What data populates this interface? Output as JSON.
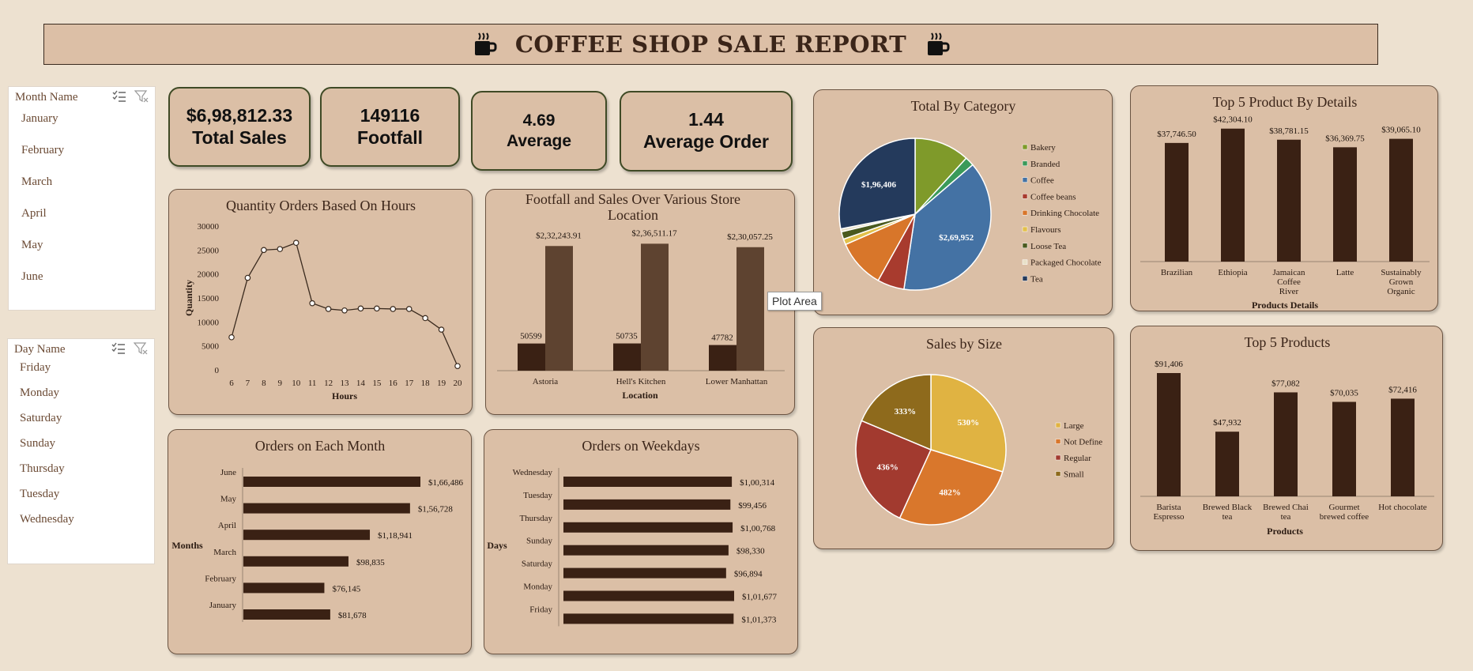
{
  "header": {
    "title": "COFFEE SHOP SALE REPORT",
    "icon": "coffee-cup-icon"
  },
  "tooltip": "Plot Area",
  "slicers": {
    "month": {
      "title": "Month Name",
      "items": [
        "January",
        "February",
        "March",
        "April",
        "May",
        "June"
      ]
    },
    "day": {
      "title": "Day Name",
      "items": [
        "Friday",
        "Monday",
        "Saturday",
        "Sunday",
        "Thursday",
        "Tuesday",
        "Wednesday"
      ]
    }
  },
  "kpis": [
    {
      "value": "$6,98,812.33",
      "label": "Total Sales"
    },
    {
      "value": "149116",
      "label": "Footfall"
    },
    {
      "value": "4.69",
      "label": "Average"
    },
    {
      "value": "1.44",
      "label": "Average Order"
    }
  ],
  "colors": {
    "dark_bar": "#3a2114",
    "mid_bar": "#5e4330",
    "panel": "#dbbfa6",
    "line": "#3a2a1e"
  },
  "chart_data": [
    {
      "id": "hours",
      "type": "line",
      "title": "Quantity Orders Based On Hours",
      "xlabel": "Hours",
      "ylabel": "Quantity",
      "x": [
        6,
        7,
        8,
        9,
        10,
        11,
        12,
        13,
        14,
        15,
        16,
        17,
        18,
        19,
        20
      ],
      "y": [
        6800,
        19200,
        25000,
        25200,
        26500,
        13900,
        12700,
        12400,
        12800,
        12800,
        12700,
        12700,
        10800,
        8400,
        800
      ],
      "ylim": [
        0,
        30000
      ],
      "yticks": [
        "0",
        "5000",
        "10000",
        "15000",
        "20000",
        "25000",
        "30000"
      ],
      "grid": false
    },
    {
      "id": "location",
      "type": "bar",
      "title": "Footfall and Sales Over Various Store Location",
      "xlabel": "Location",
      "categories": [
        "Astoria",
        "Hell's Kitchen",
        "Lower Manhattan"
      ],
      "series": [
        {
          "values": [
            50599,
            50735,
            47782
          ],
          "labels": [
            "50599",
            "50735",
            "47782"
          ]
        },
        {
          "values": [
            232243.91,
            236511.17,
            230057.25
          ],
          "labels": [
            "$2,32,243.91",
            "$2,36,511.17",
            "$2,30,057.25"
          ]
        }
      ]
    },
    {
      "id": "category",
      "type": "pie",
      "title": "Total By Category",
      "legend": "right",
      "categories": [
        "Bakery",
        "Branded",
        "Coffee",
        "Coffee beans",
        "Drinking Chocolate",
        "Flavours",
        "Loose Tea",
        "Packaged Chocolate",
        "Tea"
      ],
      "values": [
        82316,
        13607,
        269952,
        40085,
        72416,
        8408,
        11213,
        4408,
        196406
      ],
      "colors": [
        "#7f9a2a",
        "#3a9a5a",
        "#4472a4",
        "#a83b2e",
        "#d8762a",
        "#e2c04a",
        "#4a5a1e",
        "#e8e0c8",
        "#243a5c"
      ],
      "data_labels": {
        "Coffee": "$2,69,952",
        "Tea": "$1,96,406"
      }
    },
    {
      "id": "top5-details",
      "type": "bar",
      "title": "Top 5 Product By Details",
      "xlabel": "Products Details",
      "categories": [
        "Brazilian",
        "Ethiopia",
        "Jamaican Coffee River",
        "Latte",
        "Sustainably Grown Organic"
      ],
      "values": [
        37746.5,
        42304.1,
        38781.15,
        36369.75,
        39065.1
      ],
      "labels": [
        "$37,746.50",
        "$42,304.10",
        "$38,781.15",
        "$36,369.75",
        "$39,065.10"
      ]
    },
    {
      "id": "size",
      "type": "pie",
      "title": "Sales by Size",
      "legend": "right",
      "categories": [
        "Large",
        "Not Define",
        "Regular",
        "Small"
      ],
      "values": [
        530,
        482,
        436,
        333
      ],
      "labels": [
        "530%",
        "482%",
        "436%",
        "333%"
      ],
      "colors": [
        "#e0b342",
        "#d9772c",
        "#a23a2f",
        "#8e6a1c"
      ]
    },
    {
      "id": "top5-products",
      "type": "bar",
      "title": "Top 5 Products",
      "xlabel": "Products",
      "categories": [
        "Barista Espresso",
        "Brewed Black tea",
        "Brewed Chai tea",
        "Gourmet brewed coffee",
        "Hot chocolate"
      ],
      "values": [
        91406,
        47932,
        77082,
        70035,
        72416
      ],
      "labels": [
        "$91,406",
        "$47,932",
        "$77,082",
        "$70,035",
        "$72,416"
      ]
    },
    {
      "id": "month",
      "type": "bar",
      "orientation": "horizontal",
      "title": "Orders on Each Month",
      "ylabel": "Months",
      "categories": [
        "June",
        "May",
        "April",
        "March",
        "February",
        "January"
      ],
      "values": [
        166486,
        156728,
        118941,
        98835,
        76145,
        81678
      ],
      "labels": [
        "$1,66,486",
        "$1,56,728",
        "$1,18,941",
        "$98,835",
        "$76,145",
        "$81,678"
      ]
    },
    {
      "id": "weekday",
      "type": "bar",
      "orientation": "horizontal",
      "title": "Orders on Weekdays",
      "ylabel": "Days",
      "categories": [
        "Wednesday",
        "Tuesday",
        "Thursday",
        "Sunday",
        "Saturday",
        "Monday",
        "Friday"
      ],
      "values": [
        100314,
        99456,
        100768,
        98330,
        96894,
        101677,
        101373
      ],
      "labels": [
        "$1,00,314",
        "$99,456",
        "$1,00,768",
        "$98,330",
        "$96,894",
        "$1,01,677",
        "$1,01,373"
      ]
    }
  ]
}
